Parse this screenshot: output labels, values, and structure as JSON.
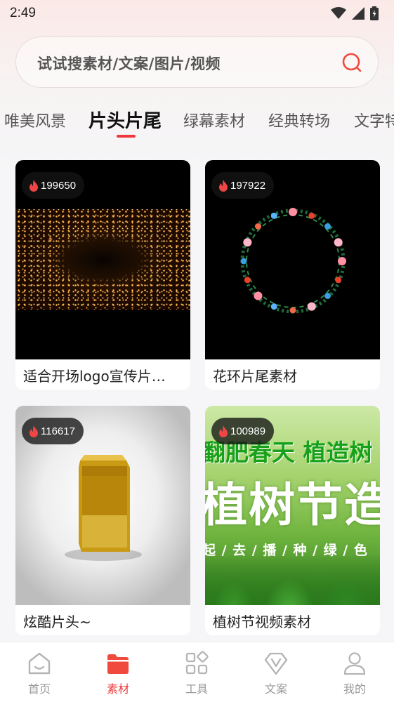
{
  "status_bar": {
    "time": "2:49"
  },
  "search": {
    "placeholder": "试试搜素材/文案/图片/视频"
  },
  "tabs": [
    {
      "label": "唯美风景"
    },
    {
      "label": "片头片尾",
      "active": true
    },
    {
      "label": "绿幕素材"
    },
    {
      "label": "经典转场"
    },
    {
      "label": "文字特"
    }
  ],
  "cards": [
    {
      "title": "适合开场logo宣传片…",
      "views": "199650"
    },
    {
      "title": "花环片尾素材",
      "views": "197922"
    },
    {
      "title": "炫酷片头~",
      "views": "116617"
    },
    {
      "title": "植树节视频素材",
      "views": "100989"
    }
  ],
  "thumb4_text": {
    "top": "翻肥春天 植造树",
    "big": "植树节造林",
    "row": "起 / 去 / 播 / 种 / 绿 / 色"
  },
  "bottom_nav": [
    {
      "label": "首页",
      "icon": "home-icon"
    },
    {
      "label": "素材",
      "icon": "folder-icon",
      "active": true
    },
    {
      "label": "工具",
      "icon": "grid-icon"
    },
    {
      "label": "文案",
      "icon": "v-diamond-icon"
    },
    {
      "label": "我的",
      "icon": "user-icon"
    }
  ],
  "colors": {
    "accent": "#f0353d",
    "nav_inactive": "#9a9a9a"
  }
}
